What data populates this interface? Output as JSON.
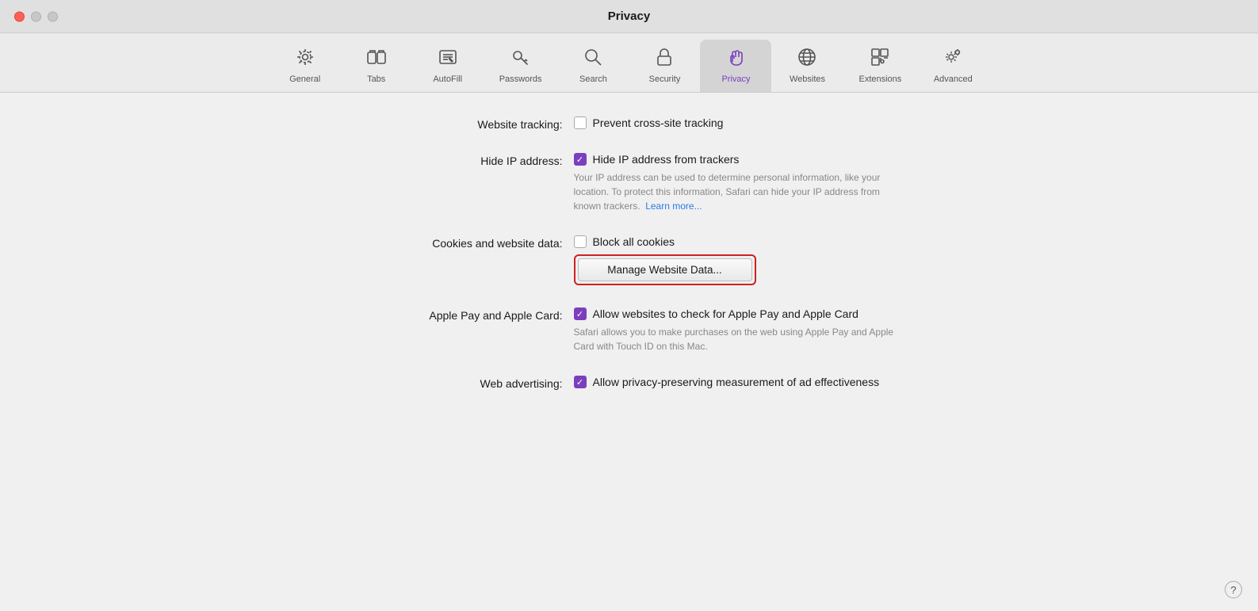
{
  "window": {
    "title": "Privacy"
  },
  "toolbar": {
    "items": [
      {
        "id": "general",
        "label": "General",
        "icon": "gear"
      },
      {
        "id": "tabs",
        "label": "Tabs",
        "icon": "tabs"
      },
      {
        "id": "autofill",
        "label": "AutoFill",
        "icon": "autofill"
      },
      {
        "id": "passwords",
        "label": "Passwords",
        "icon": "key"
      },
      {
        "id": "search",
        "label": "Search",
        "icon": "search"
      },
      {
        "id": "security",
        "label": "Security",
        "icon": "lock"
      },
      {
        "id": "privacy",
        "label": "Privacy",
        "icon": "hand",
        "active": true
      },
      {
        "id": "websites",
        "label": "Websites",
        "icon": "globe"
      },
      {
        "id": "extensions",
        "label": "Extensions",
        "icon": "puzzle"
      },
      {
        "id": "advanced",
        "label": "Advanced",
        "icon": "gear-advanced"
      }
    ]
  },
  "settings": {
    "website_tracking": {
      "label": "Website tracking:",
      "checkbox_checked": false,
      "text": "Prevent cross-site tracking"
    },
    "hide_ip": {
      "label": "Hide IP address:",
      "checkbox_checked": true,
      "text": "Hide IP address from trackers",
      "description": "Your IP address can be used to determine personal information, like your location. To protect this information, Safari can hide your IP address from known trackers.",
      "link_text": "Learn more..."
    },
    "cookies": {
      "label": "Cookies and website data:",
      "checkbox_checked": false,
      "text": "Block all cookies",
      "button_label": "Manage Website Data..."
    },
    "apple_pay": {
      "label": "Apple Pay and Apple Card:",
      "checkbox_checked": true,
      "text": "Allow websites to check for Apple Pay and Apple Card",
      "description": "Safari allows you to make purchases on the web using Apple Pay and Apple Card with Touch ID on this Mac."
    },
    "web_advertising": {
      "label": "Web advertising:",
      "checkbox_checked": true,
      "text": "Allow privacy-preserving measurement of ad effectiveness"
    }
  },
  "help": "?"
}
